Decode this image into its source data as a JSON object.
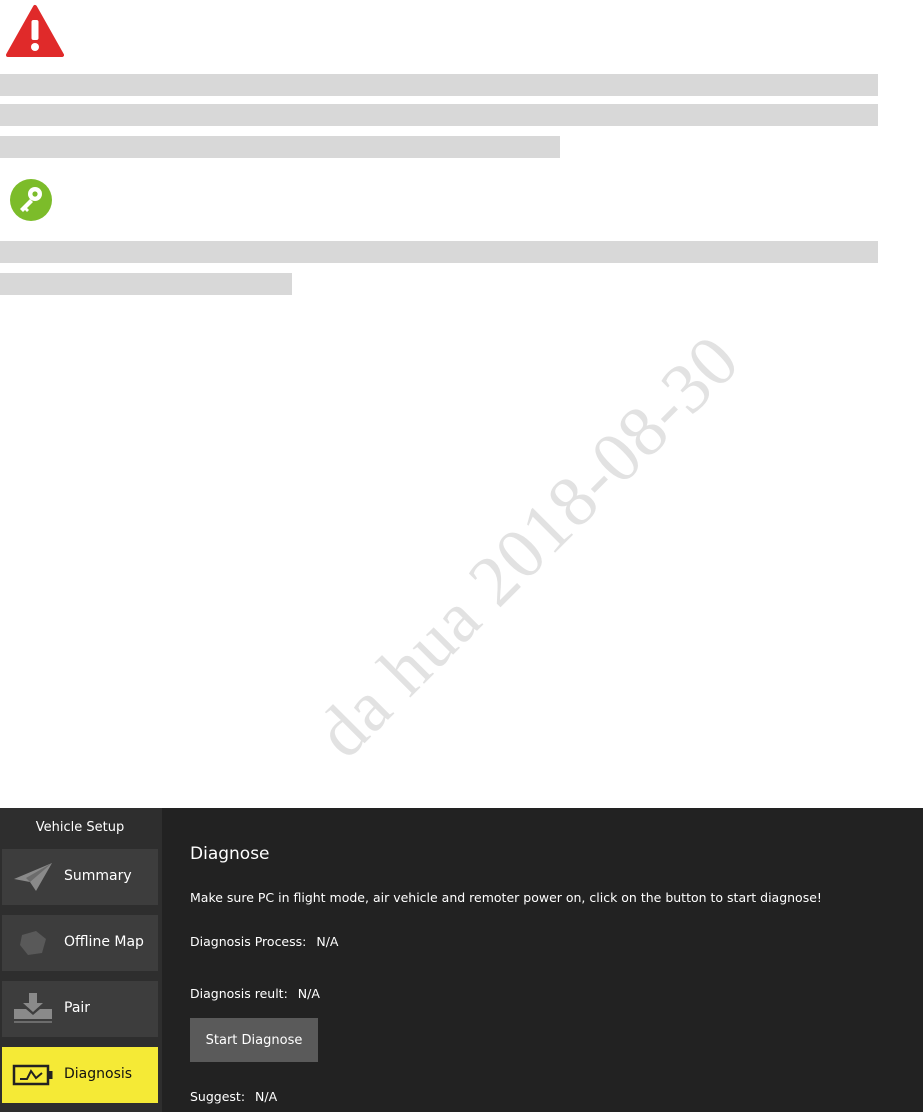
{
  "watermark": {
    "text": "da hua 2018-08-30"
  },
  "icons": {
    "warning": "warning-triangle-icon",
    "tip": "key-icon"
  },
  "colors": {
    "warning_red": "#e02a2a",
    "tip_green": "#7cbc2a",
    "window_bg": "#222222",
    "sidebar_bg": "#2e2e2e",
    "nav_item_bg": "#3d3d3d",
    "nav_active_bg": "#f5ea36",
    "button_bg": "#5a5a5a"
  },
  "app": {
    "sidebar": {
      "title": "Vehicle Setup",
      "items": [
        {
          "label": "Summary",
          "icon": "paper-plane-icon",
          "active": false
        },
        {
          "label": "Offline Map",
          "icon": "map-icon",
          "active": false
        },
        {
          "label": "Pair",
          "icon": "download-tray-icon",
          "active": false
        },
        {
          "label": "Diagnosis",
          "icon": "battery-pulse-icon",
          "active": true
        }
      ]
    },
    "main": {
      "title": "Diagnose",
      "instruction": "Make sure PC in flight mode, air vehicle and remoter power on, click on the button to start diagnose!",
      "process_label": "Diagnosis Process:",
      "process_value": "N/A",
      "result_label": "Diagnosis reult:",
      "result_value": "N/A",
      "start_button": "Start Diagnose",
      "suggest_label": "Suggest:",
      "suggest_value": "N/A"
    }
  }
}
